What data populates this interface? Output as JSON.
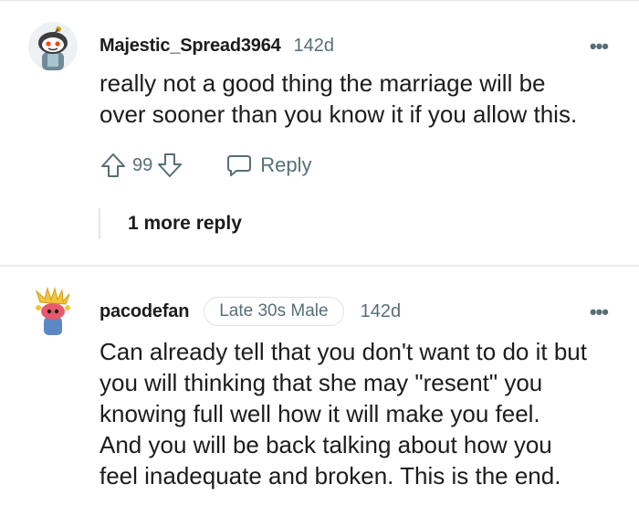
{
  "comments": [
    {
      "username": "Majestic_Spread3964",
      "age": "142d",
      "body": "really not a good thing the marriage will be\nover sooner than you know it if you allow this.",
      "votes": "99",
      "reply_label": "Reply",
      "more_replies": "1 more reply",
      "overflow_icon": "ellipsis-icon",
      "avatar_icon": "snoo-avatar"
    },
    {
      "username": "pacodefan",
      "flair": "Late 30s Male",
      "age": "142d",
      "body": "Can already tell that you don't want to do it but\nyou will thinking that she may \"resent\" you\nknowing full well how it will make you feel.\nAnd you will be back talking about how you\nfeel inadequate and broken. This is the end.",
      "overflow_icon": "ellipsis-icon",
      "avatar_icon": "snoo-avatar"
    }
  ],
  "colors": {
    "text": "#1c1c1c",
    "muted": "#576f76",
    "divider": "#e8eaec"
  }
}
